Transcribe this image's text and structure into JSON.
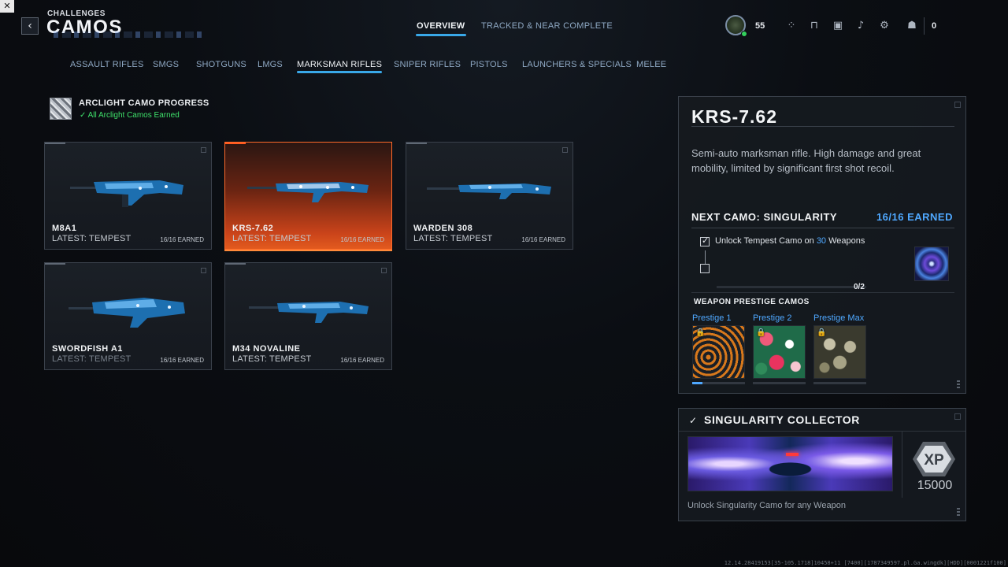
{
  "header": {
    "breadcrumb": "CHALLENGES",
    "title": "CAMOS",
    "tabs": [
      {
        "label": "OVERVIEW",
        "active": true
      },
      {
        "label": "TRACKED & NEAR COMPLETE",
        "active": false
      }
    ],
    "player_level": "55",
    "squad_count": "0"
  },
  "categories": [
    {
      "label": "ASSAULT RIFLES",
      "active": false
    },
    {
      "label": "SMGS",
      "active": false
    },
    {
      "label": "SHOTGUNS",
      "active": false
    },
    {
      "label": "LMGS",
      "active": false
    },
    {
      "label": "MARKSMAN RIFLES",
      "active": true
    },
    {
      "label": "SNIPER RIFLES",
      "active": false
    },
    {
      "label": "PISTOLS",
      "active": false
    },
    {
      "label": "LAUNCHERS & SPECIALS",
      "active": false
    },
    {
      "label": "MELEE",
      "active": false
    }
  ],
  "progress": {
    "title": "ARCLIGHT CAMO PROGRESS",
    "status": "All Arclight Camos Earned"
  },
  "weapons": [
    {
      "name": "M8A1",
      "latest": "LATEST: TEMPEST",
      "earned": "16/16 EARNED",
      "selected": false
    },
    {
      "name": "KRS-7.62",
      "latest": "LATEST: TEMPEST",
      "earned": "16/16 EARNED",
      "selected": true
    },
    {
      "name": "WARDEN 308",
      "latest": "LATEST: TEMPEST",
      "earned": "16/16 EARNED",
      "selected": false
    },
    {
      "name": "SWORDFISH A1",
      "latest": "LATEST: TEMPEST",
      "earned": "16/16 EARNED",
      "selected": false
    },
    {
      "name": "M34 NOVALINE",
      "latest": "LATEST: TEMPEST",
      "earned": "16/16 EARNED",
      "selected": false
    }
  ],
  "detail": {
    "title": "KRS-7.62",
    "description": "Semi-auto marksman rifle. High damage and great mobility, limited by significant first shot recoil.",
    "next_camo_label": "NEXT CAMO: SINGULARITY",
    "next_camo_earned": "16/16 EARNED",
    "challenge": {
      "text_before": "Unlock Tempest Camo on ",
      "number": "30",
      "text_after": " Weapons",
      "progress_text": "0/2",
      "progress_fraction": 0
    },
    "prestige_header": "WEAPON PRESTIGE CAMOS",
    "prestige": [
      {
        "label": "Prestige 1",
        "progress_fraction": 0.2
      },
      {
        "label": "Prestige 2",
        "progress_fraction": 0
      },
      {
        "label": "Prestige Max",
        "progress_fraction": 0
      }
    ]
  },
  "collector": {
    "title": "SINGULARITY COLLECTOR",
    "xp_badge": "XP",
    "xp_amount": "15000",
    "description": "Unlock Singularity Camo for any Weapon"
  },
  "footer": {
    "build": "12.14.28419153[35-105.1718]10458+11 [7400][1787349597.pl.Ga.wingdk][HDD][0001221f100]"
  },
  "colors": {
    "accent_blue": "#39a8e8",
    "earned_blue": "#4fa8ff",
    "selected_orange": "#e25a1e",
    "success_green": "#3ee06a"
  }
}
